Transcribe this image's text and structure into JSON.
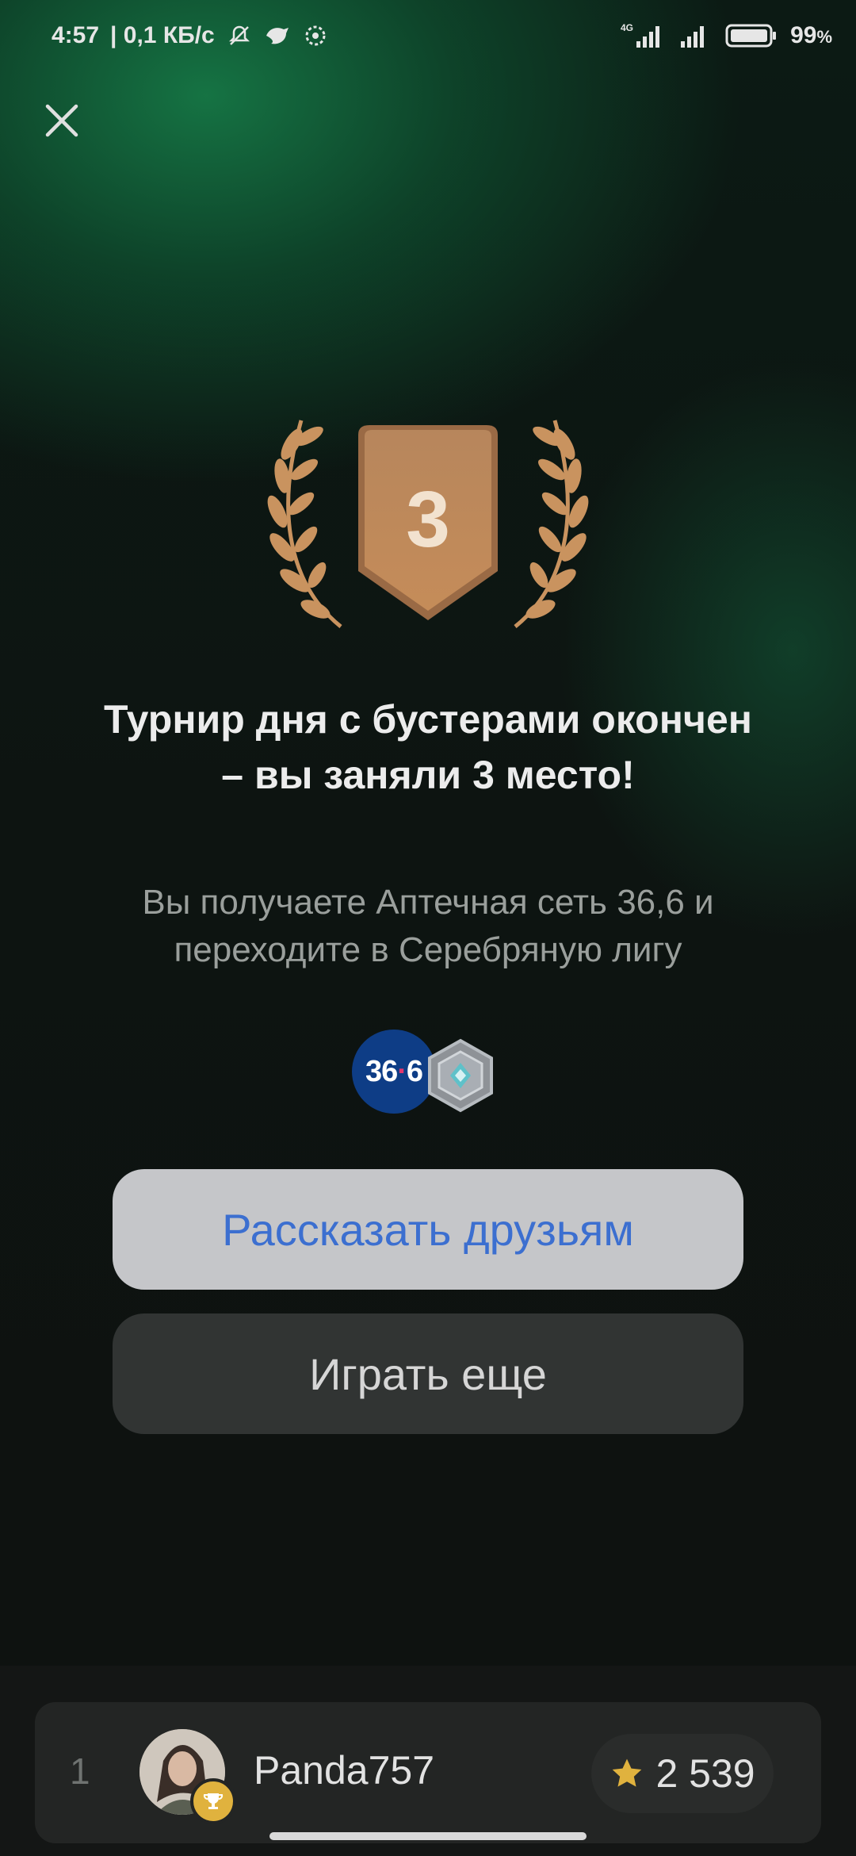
{
  "status_bar": {
    "time": "4:57",
    "speed": "| 0,1 КБ/с",
    "network": "4G",
    "battery": "99",
    "battery_unit": "%"
  },
  "icons": {
    "close": "close-icon",
    "bell_off": "bell-off-icon",
    "app1": "bird-icon",
    "app2": "settings-badge-icon",
    "signal": "signal-icon",
    "battery": "battery-icon",
    "medal": "bronze-medal-icon",
    "league": "silver-league-icon",
    "star": "star-icon",
    "trophy": "trophy-icon"
  },
  "medal": {
    "place": "3"
  },
  "headline": "Турнир дня с бустерами окончен – вы заняли 3 место!",
  "subtext": "Вы получаете Аптечная сеть 36,6 и переходите в Серебряную лигу",
  "rewards": {
    "pharmacy_logo_left": "36",
    "pharmacy_logo_dot": "·",
    "pharmacy_logo_right": "6"
  },
  "buttons": {
    "share": "Рассказать друзьям",
    "play_again": "Играть еще"
  },
  "leaderboard": {
    "rank": "1",
    "username": "Panda757",
    "score": "2 539"
  },
  "colors": {
    "accent_green": "#16784a",
    "share_text": "#3c6fd0",
    "medal_bronze": "#c98a55",
    "star_gold": "#e0b23e"
  }
}
